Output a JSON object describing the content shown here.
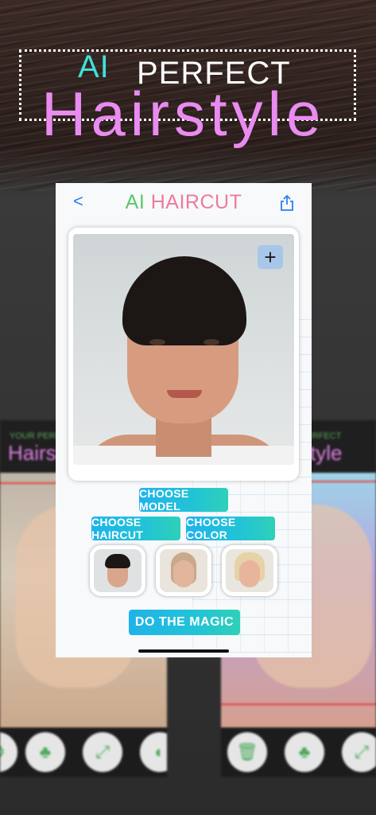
{
  "headline": {
    "ai": "AI",
    "perfect": "PERFECT",
    "hairstyle": "Hairstyle"
  },
  "background_preview": {
    "left_tagline": "YOUR PERFECT",
    "left_title": "Hairstyle",
    "right_tagline": "PERFECT",
    "right_title": "tyle"
  },
  "app": {
    "title_ai": "AI",
    "title_rest": " HAIRCUT",
    "back_glyph": "<",
    "add_glyph": "+"
  },
  "buttons": {
    "choose_model": "CHOOSE MODEL",
    "choose_haircut": "CHOOSE HAIRCUT",
    "choose_color": "CHOOSE COLOR",
    "do_magic": "DO THE MAGIC"
  },
  "icons": {
    "back": "chevron-left-icon",
    "share": "share-icon",
    "add": "plus-icon"
  },
  "colors": {
    "title_ai": "#5bc76a",
    "title_haircut": "#f07a9a",
    "accent_button": "#1fb3ea",
    "headline_ai": "#3fe0da",
    "headline_hairstyle": "#e98bf0"
  }
}
